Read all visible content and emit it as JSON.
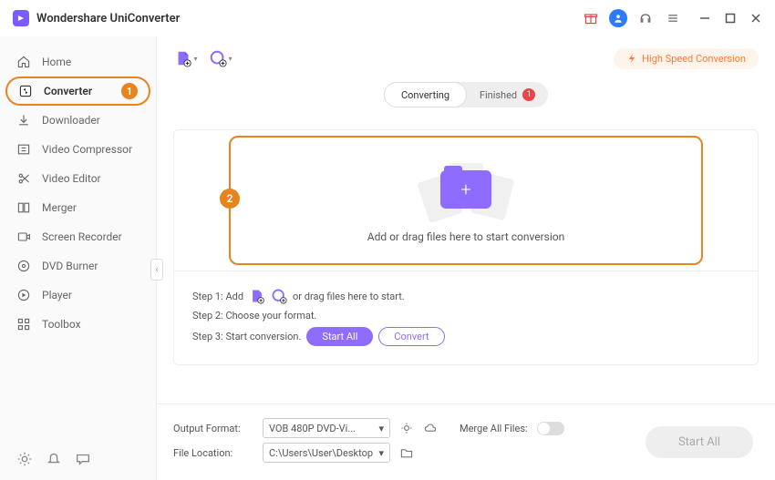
{
  "app_title": "Wondershare UniConverter",
  "sidebar": {
    "items": [
      {
        "label": "Home",
        "icon": "home"
      },
      {
        "label": "Converter",
        "icon": "converter",
        "active": true,
        "badge": "1"
      },
      {
        "label": "Downloader",
        "icon": "download"
      },
      {
        "label": "Video Compressor",
        "icon": "compress"
      },
      {
        "label": "Video Editor",
        "icon": "scissors"
      },
      {
        "label": "Merger",
        "icon": "merger"
      },
      {
        "label": "Screen Recorder",
        "icon": "record"
      },
      {
        "label": "DVD Burner",
        "icon": "disc"
      },
      {
        "label": "Player",
        "icon": "play"
      },
      {
        "label": "Toolbox",
        "icon": "grid"
      }
    ]
  },
  "tabs": {
    "converting": "Converting",
    "finished": "Finished",
    "finished_count": "1"
  },
  "high_speed_label": "High Speed Conversion",
  "drop_zone": {
    "badge": "2",
    "text": "Add or drag files here to start conversion"
  },
  "steps": {
    "s1_prefix": "Step 1: Add",
    "s1_suffix": "or drag files here to start.",
    "s2": "Step 2: Choose your format.",
    "s3": "Step 3: Start conversion.",
    "start_all": "Start All",
    "convert": "Convert"
  },
  "footer": {
    "output_format_label": "Output Format:",
    "output_format_value": "VOB 480P DVD-Vi...",
    "file_location_label": "File Location:",
    "file_location_value": "C:\\Users\\User\\Desktop",
    "merge_label": "Merge All Files:",
    "start_all": "Start All"
  }
}
